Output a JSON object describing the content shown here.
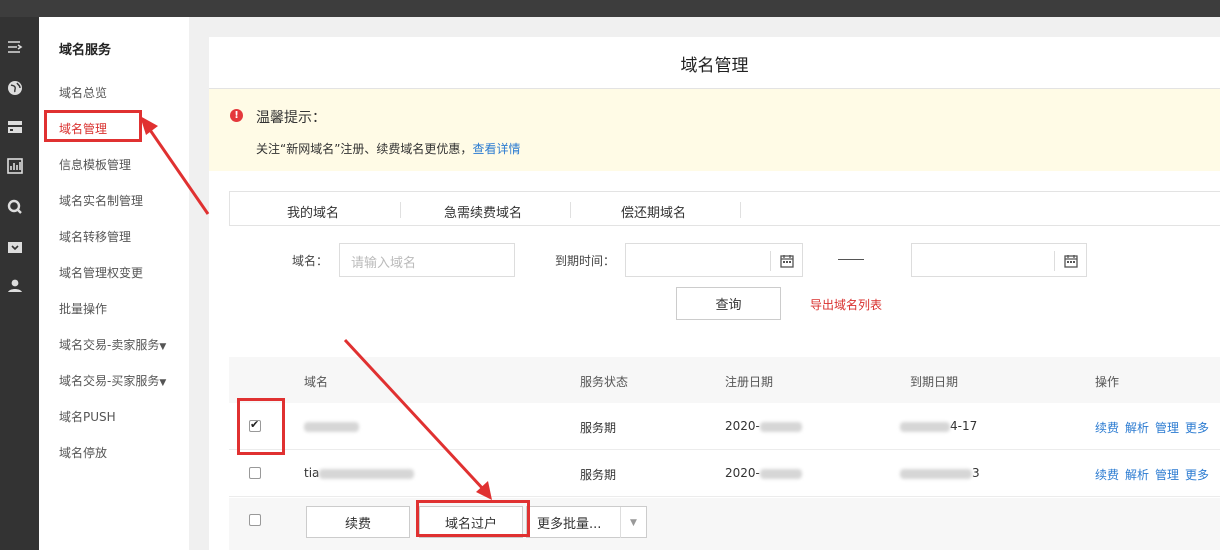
{
  "sidebar": {
    "title": "域名服务",
    "items": [
      {
        "label": "域名总览"
      },
      {
        "label": "域名管理"
      },
      {
        "label": "信息模板管理"
      },
      {
        "label": "域名实名制管理"
      },
      {
        "label": "域名转移管理"
      },
      {
        "label": "域名管理权变更"
      },
      {
        "label": "批量操作"
      },
      {
        "label": "域名交易-卖家服务"
      },
      {
        "label": "域名交易-买家服务"
      },
      {
        "label": "域名PUSH"
      },
      {
        "label": "域名停放"
      }
    ]
  },
  "main": {
    "title": "域名管理",
    "notice": {
      "title": "温馨提示：",
      "text": "关注“新网域名”注册、续费域名更优惠，",
      "link": "查看详情"
    },
    "tabs": [
      {
        "label": "我的域名"
      },
      {
        "label": "急需续费域名"
      },
      {
        "label": "偿还期域名"
      }
    ],
    "filter": {
      "domain_label": "域名：",
      "domain_placeholder": "请输入域名",
      "expire_label": "到期时间：",
      "query_button": "查询",
      "export_link": "导出域名列表"
    },
    "table": {
      "headers": [
        "域名",
        "服务状态",
        "注册日期",
        "到期日期",
        "操作"
      ],
      "rows": [
        {
          "domain": "",
          "status": "服务期",
          "reg_date": "2020-",
          "exp_date": "4-17",
          "checked": true
        },
        {
          "domain": "tia",
          "status": "服务期",
          "reg_date": "2020-",
          "exp_date": "3",
          "checked": false
        }
      ],
      "ops": [
        "续费",
        "解析",
        "管理",
        "更多"
      ]
    },
    "bulk": {
      "renew_button": "续费",
      "transfer_button": "域名过户",
      "more_button": "更多批量..."
    }
  },
  "colors": {
    "accent_red": "#e03131",
    "link_blue": "#2b7bd1",
    "notice_bg": "#fffbe6"
  }
}
